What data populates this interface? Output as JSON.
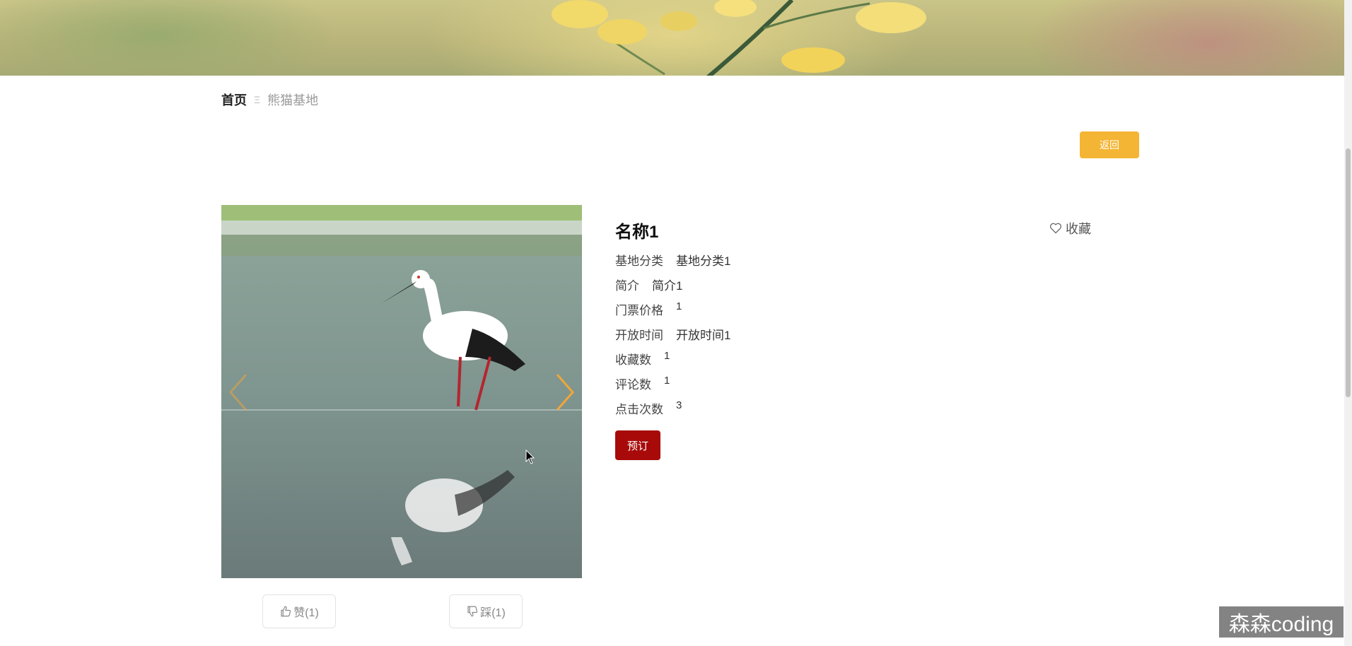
{
  "breadcrumb": {
    "home": "首页",
    "separator": "Ξ",
    "current": "熊猫基地"
  },
  "actions": {
    "back": "返回",
    "book": "预订",
    "favorite": "收藏"
  },
  "detail": {
    "name": "名称1",
    "fields": [
      {
        "label": "基地分类",
        "value": "基地分类1"
      },
      {
        "label": "简介",
        "value": "简介1"
      },
      {
        "label": "门票价格",
        "value": "1"
      },
      {
        "label": "开放时间",
        "value": "开放时间1"
      },
      {
        "label": "收藏数",
        "value": "1"
      },
      {
        "label": "评论数",
        "value": "1"
      },
      {
        "label": "点击次数",
        "value": "3"
      }
    ]
  },
  "votes": {
    "like": "赞(1)",
    "dislike": "踩(1)"
  },
  "watermark": "森森coding",
  "colors": {
    "back_button": "#f4b534",
    "book_button": "#a80a0a",
    "arrow": "#f0a63a"
  }
}
